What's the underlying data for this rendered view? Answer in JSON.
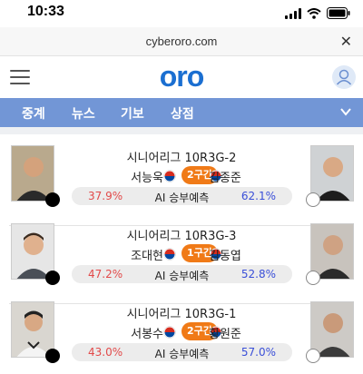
{
  "status_bar": {
    "time": "10:33"
  },
  "browser": {
    "url": "cyberoro.com"
  },
  "header": {
    "logo": "oro"
  },
  "nav": {
    "items": [
      "중계",
      "뉴스",
      "기보",
      "상점"
    ]
  },
  "icons": {
    "menu": "hamburger-menu-icon",
    "user": "user-icon",
    "close": "close-icon",
    "expand": "chevron-down-icon",
    "flag": "korea-flag-icon"
  },
  "colors": {
    "accent": "#1b6fd1",
    "nav_bg": "#7296d6",
    "pill": "#f07a17",
    "black_pct": "#e24a4a",
    "white_pct": "#3a4fd8"
  },
  "matches": [
    {
      "league": "시니어리그 10R3G-2",
      "black_player": "서능욱",
      "white_player": "김종준",
      "stage": "2구간",
      "prediction_label": "AI 승부예측",
      "black_pct": "37.9%",
      "white_pct": "62.1%"
    },
    {
      "league": "시니어리그 10R3G-3",
      "black_player": "조대현",
      "white_player": "김동엽",
      "stage": "1구간",
      "prediction_label": "AI 승부예측",
      "black_pct": "47.2%",
      "white_pct": "52.8%"
    },
    {
      "league": "시니어리그 10R3G-1",
      "black_player": "서봉수",
      "white_player": "황원준",
      "stage": "2구간",
      "prediction_label": "AI 승부예측",
      "black_pct": "43.0%",
      "white_pct": "57.0%"
    }
  ]
}
